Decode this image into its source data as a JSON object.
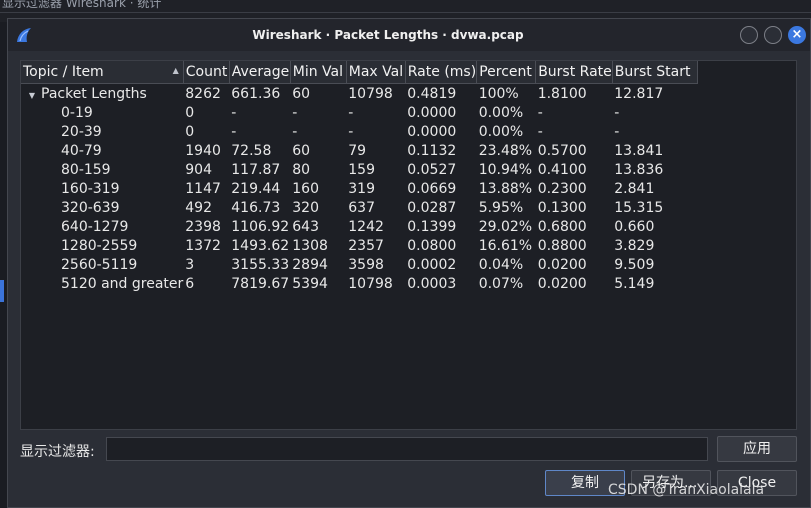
{
  "background": {
    "text": "显示过滤器 Wireshark · 统计"
  },
  "window": {
    "title": "Wireshark · Packet Lengths · dvwa.pcap",
    "close_glyph": "×"
  },
  "table": {
    "headers": [
      "Topic / Item",
      "Count",
      "Average",
      "Min Val",
      "Max Val",
      "Rate (ms)",
      "Percent",
      "Burst Rate",
      "Burst Start"
    ],
    "parent": [
      "Packet Lengths",
      "8262",
      "661.36",
      "60",
      "10798",
      "0.4819",
      "100%",
      "1.8100",
      "12.817"
    ],
    "rows": [
      [
        "0-19",
        "0",
        "-",
        "-",
        "-",
        "0.0000",
        "0.00%",
        "-",
        "-"
      ],
      [
        "20-39",
        "0",
        "-",
        "-",
        "-",
        "0.0000",
        "0.00%",
        "-",
        "-"
      ],
      [
        "40-79",
        "1940",
        "72.58",
        "60",
        "79",
        "0.1132",
        "23.48%",
        "0.5700",
        "13.841"
      ],
      [
        "80-159",
        "904",
        "117.87",
        "80",
        "159",
        "0.0527",
        "10.94%",
        "0.4100",
        "13.836"
      ],
      [
        "160-319",
        "1147",
        "219.44",
        "160",
        "319",
        "0.0669",
        "13.88%",
        "0.2300",
        "2.841"
      ],
      [
        "320-639",
        "492",
        "416.73",
        "320",
        "637",
        "0.0287",
        "5.95%",
        "0.1300",
        "15.315"
      ],
      [
        "640-1279",
        "2398",
        "1106.92",
        "643",
        "1242",
        "0.1399",
        "29.02%",
        "0.6800",
        "0.660"
      ],
      [
        "1280-2559",
        "1372",
        "1493.62",
        "1308",
        "2357",
        "0.0800",
        "16.61%",
        "0.8800",
        "3.829"
      ],
      [
        "2560-5119",
        "3",
        "3155.33",
        "2894",
        "3598",
        "0.0002",
        "0.04%",
        "0.0200",
        "9.509"
      ],
      [
        "5120 and greater",
        "6",
        "7819.67",
        "5394",
        "10798",
        "0.0003",
        "0.07%",
        "0.0200",
        "5.149"
      ]
    ]
  },
  "filter": {
    "label": "显示过滤器:",
    "value": "",
    "apply_label": "应用"
  },
  "buttons": {
    "copy": "复制",
    "save_as": "另存为...",
    "close": "Close"
  },
  "watermark": "CSDN @TranXiaolalala",
  "colors": {
    "accent": "#3b78e0",
    "background": "#2b2e36",
    "table_bg": "#1d1f25"
  }
}
